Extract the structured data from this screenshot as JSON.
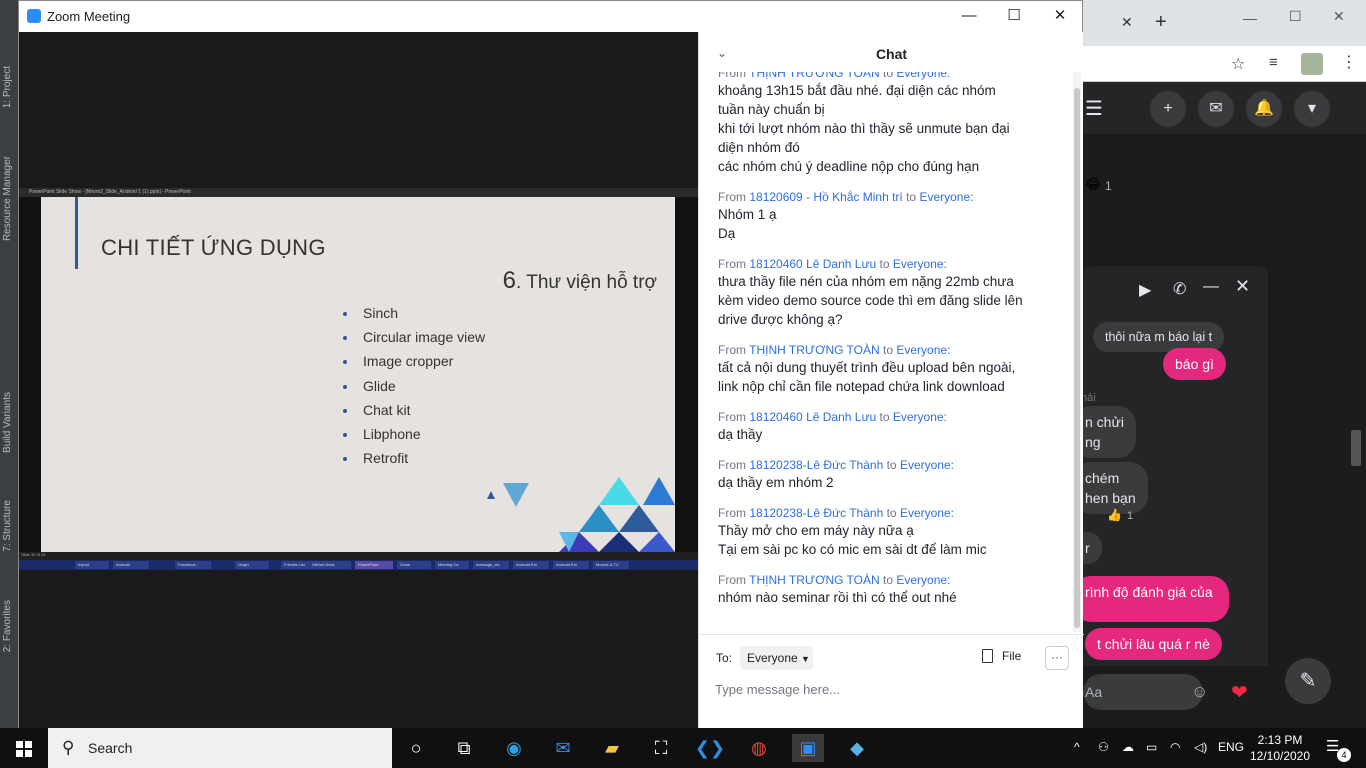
{
  "android_studio": {
    "side_tabs": [
      "1: Project",
      "Resource Manager",
      "Build Variants",
      "7: Structure",
      "2: Favorites"
    ]
  },
  "zoom": {
    "title": "Zoom Meeting",
    "controls": {
      "minimize": "—",
      "maximize": "☐",
      "close": "✕"
    }
  },
  "shared_screen": {
    "window_caption": "PowerPoint Slide Show - [Nhom2_Slide_Android 1 (1).pptx] - PowerPoint",
    "slide_status": "Slide 30 of 33",
    "slide": {
      "title": "CHI TIẾT ỨNG DỤNG",
      "subtitle_number": "6",
      "subtitle_text": ". Thư viện hỗ trợ",
      "bullets": [
        "Sinch",
        "Circular image view",
        "Image cropper",
        "Glide",
        "Chat kit",
        "Libphone",
        "Retrofit"
      ]
    },
    "mini_taskbar": [
      "export",
      "Android",
      "Facebook -",
      "Origin",
      "Friends List",
      "GitHub Desk",
      "PowerPoint",
      "Zoom",
      "Meeting Ca",
      "message_cle",
      "Android Em",
      "Android Em",
      "Movies & TV"
    ]
  },
  "chat": {
    "title": "Chat",
    "messages": [
      {
        "prefix": "From ",
        "sender": "THỊNH TRƯƠNG TOÀN",
        "to_word": " to ",
        "recipient": "Everyone:",
        "lines": [
          "khoảng 13h15 bắt đầu nhé. đại diện các nhóm",
          "tuần này chuẩn bị",
          "khi tới lượt nhóm nào thì thầy sẽ unmute bạn đại",
          "diện nhóm đó",
          "các nhóm chú ý deadline nộp cho đúng hạn"
        ]
      },
      {
        "prefix": "From ",
        "sender": "18120609 - Hồ Khắc Minh trí",
        "to_word": " to ",
        "recipient": "Everyone:",
        "lines": [
          "Nhóm 1 ạ",
          "Dạ"
        ]
      },
      {
        "prefix": "From ",
        "sender": "18120460 Lê Danh Lưu",
        "to_word": " to ",
        "recipient": "Everyone:",
        "lines": [
          "thưa thầy file nén của nhóm em nặng 22mb chưa",
          "kèm video demo source code thì em đăng slide lên",
          "drive được không ạ?"
        ]
      },
      {
        "prefix": "From ",
        "sender": "THỊNH TRƯƠNG TOÀN",
        "to_word": " to ",
        "recipient": "Everyone:",
        "lines": [
          "tất cả nội dung thuyết trình đều upload bên ngoài,",
          "link nộp chỉ cần file notepad chứa link download"
        ]
      },
      {
        "prefix": "From ",
        "sender": "18120460 Lê Danh Lưu",
        "to_word": " to ",
        "recipient": "Everyone:",
        "lines": [
          "dạ thầy"
        ]
      },
      {
        "prefix": "From ",
        "sender": "18120238-Lê Đức Thành",
        "to_word": " to ",
        "recipient": "Everyone:",
        "lines": [
          "dạ thầy em nhóm 2"
        ]
      },
      {
        "prefix": "From ",
        "sender": "18120238-Lê Đức Thành",
        "to_word": " to ",
        "recipient": "Everyone:",
        "lines": [
          "Thầy mở cho em máy này nữa ạ",
          "Tại em sài pc ko có mic em sài dt để làm mic"
        ]
      },
      {
        "prefix": "From ",
        "sender": "THỊNH TRƯƠNG TOÀN",
        "to_word": " to ",
        "recipient": "Everyone:",
        "lines": [
          "nhóm nào seminar rồi thì có thể out nhé"
        ]
      }
    ],
    "to_label": "To:",
    "to_value": "Everyone",
    "file_label": "File",
    "more_label": "···",
    "input_placeholder": "Type message here..."
  },
  "messenger": {
    "bubbles_in": [
      "thôi nữa m báo lại t",
      "n chửi",
      "ng",
      "chém",
      "hen bạn",
      "r"
    ],
    "bubbles_out": [
      "báo gì",
      "rình độ đánh giá của",
      "t chửi lâu quá r nè"
    ],
    "reaction_count_1": "1",
    "reaction_count_2": "1",
    "input_placeholder": "Aa",
    "faded_label": "hải"
  },
  "taskbar": {
    "search_label": "Search",
    "language": "ENG",
    "time": "2:13 PM",
    "date": "12/10/2020",
    "notification_count": "4"
  }
}
